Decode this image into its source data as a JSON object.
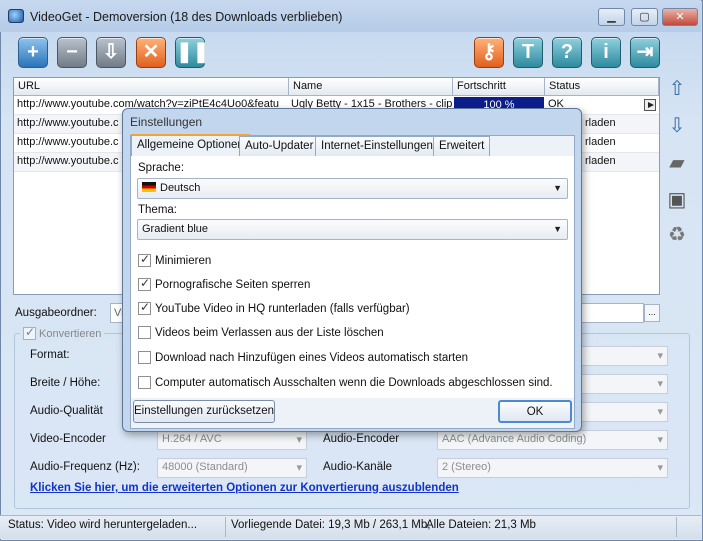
{
  "window": {
    "title": "VideoGet - Demoversion (18 des Downloads verblieben)"
  },
  "table": {
    "columns": [
      "URL",
      "Name",
      "Fortschritt",
      "Status"
    ],
    "rows": [
      {
        "url": "http://www.youtube.com/watch?v=ziPtE4c4Uo0&featu",
        "name": "Ugly Betty - 1x15 - Brothers - clip",
        "progress": "100 %",
        "status": "OK"
      },
      {
        "url": "http://www.youtube.c",
        "status": "rladen"
      },
      {
        "url": "http://www.youtube.c",
        "status": "rladen"
      },
      {
        "url": "http://www.youtube.c",
        "status": "rladen"
      }
    ]
  },
  "output": {
    "label": "Ausgabeordner:",
    "value": "Vi"
  },
  "convert": {
    "legend": "Konvertieren",
    "format_label": "Format:",
    "size_label": "Breite / Höhe:",
    "audio_quality_label": "Audio-Qualität",
    "video_encoder_label": "Video-Encoder",
    "video_encoder_value": "H.264 / AVC",
    "audio_encoder_label": "Audio-Encoder",
    "audio_encoder_value": "AAC (Advance Audio Coding)",
    "audio_freq_label": "Audio-Frequenz  (Hz):",
    "audio_freq_value": "48000 (Standard)",
    "audio_channels_label": "Audio-Kanäle",
    "audio_channels_value": "2 (Stereo)",
    "link": "Klicken Sie hier, um die erweiterten Optionen zur Konvertierung auszublenden"
  },
  "statusbar": {
    "status": "Status: Video wird heruntergeladen...",
    "file": "Vorliegende Datei: 19,3 Mb / 263,1 Mb,",
    "all": "Alle Dateien: 21,3 Mb"
  },
  "dialog": {
    "title": "Einstellungen",
    "tabs": [
      "Allgemeine Optionen",
      "Auto-Updater",
      "Internet-Einstellungen",
      "Erweitert"
    ],
    "language_label": "Sprache:",
    "language_value": "Deutsch",
    "theme_label": "Thema:",
    "theme_value": "Gradient blue",
    "options": [
      {
        "label": "Minimieren",
        "checked": true
      },
      {
        "label": "Pornografische Seiten sperren",
        "checked": true
      },
      {
        "label": "YouTube Video in HQ runterladen (falls verfügbar)",
        "checked": true
      },
      {
        "label": "Videos beim Verlassen aus der Liste löschen",
        "checked": false
      },
      {
        "label": "Download nach Hinzufügen eines Videos automatisch starten",
        "checked": false
      },
      {
        "label": "Computer automatisch Ausschalten wenn die Downloads abgeschlossen sind.",
        "checked": false
      }
    ],
    "reset_button": "Einstellungen zurücksetzen",
    "ok_button": "OK"
  }
}
